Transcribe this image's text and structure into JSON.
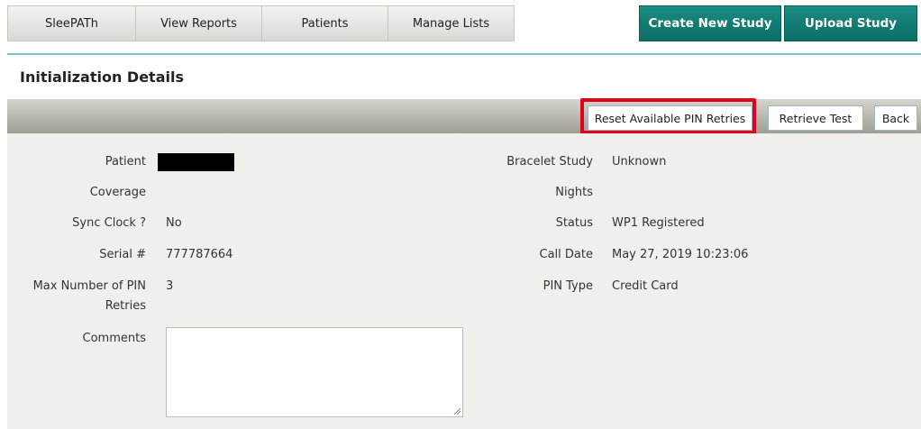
{
  "nav": {
    "tabs": [
      {
        "label": "SleePATh"
      },
      {
        "label": "View Reports"
      },
      {
        "label": "Patients"
      },
      {
        "label": "Manage Lists"
      }
    ],
    "create_label": "Create New Study",
    "upload_label": "Upload Study"
  },
  "page": {
    "title": "Initialization Details"
  },
  "toolbar": {
    "reset_label": "Reset Available PIN Retries",
    "retrieve_label": "Retrieve Test",
    "back_label": "Back"
  },
  "details_left": {
    "patient_label": "Patient",
    "patient_value": "",
    "coverage_label": "Coverage",
    "coverage_value": "",
    "sync_label": "Sync Clock ?",
    "sync_value": "No",
    "serial_label": "Serial #",
    "serial_value": "777787664",
    "max_pin_label_1": "Max Number of PIN",
    "max_pin_label_2": "Retries",
    "max_pin_value": "3",
    "comments_label": "Comments",
    "comments_value": ""
  },
  "details_right": {
    "bracelet_label": "Bracelet Study",
    "bracelet_value": "Unknown",
    "nights_label": "Nights",
    "nights_value": "",
    "status_label": "Status",
    "status_value": "WP1 Registered",
    "call_date_label": "Call Date",
    "call_date_value": "May 27, 2019 10:23:06",
    "pin_type_label": "PIN Type",
    "pin_type_value": "Credit Card"
  },
  "colors": {
    "accent_teal": "#0b6f67",
    "highlight_red": "#e3001b"
  }
}
